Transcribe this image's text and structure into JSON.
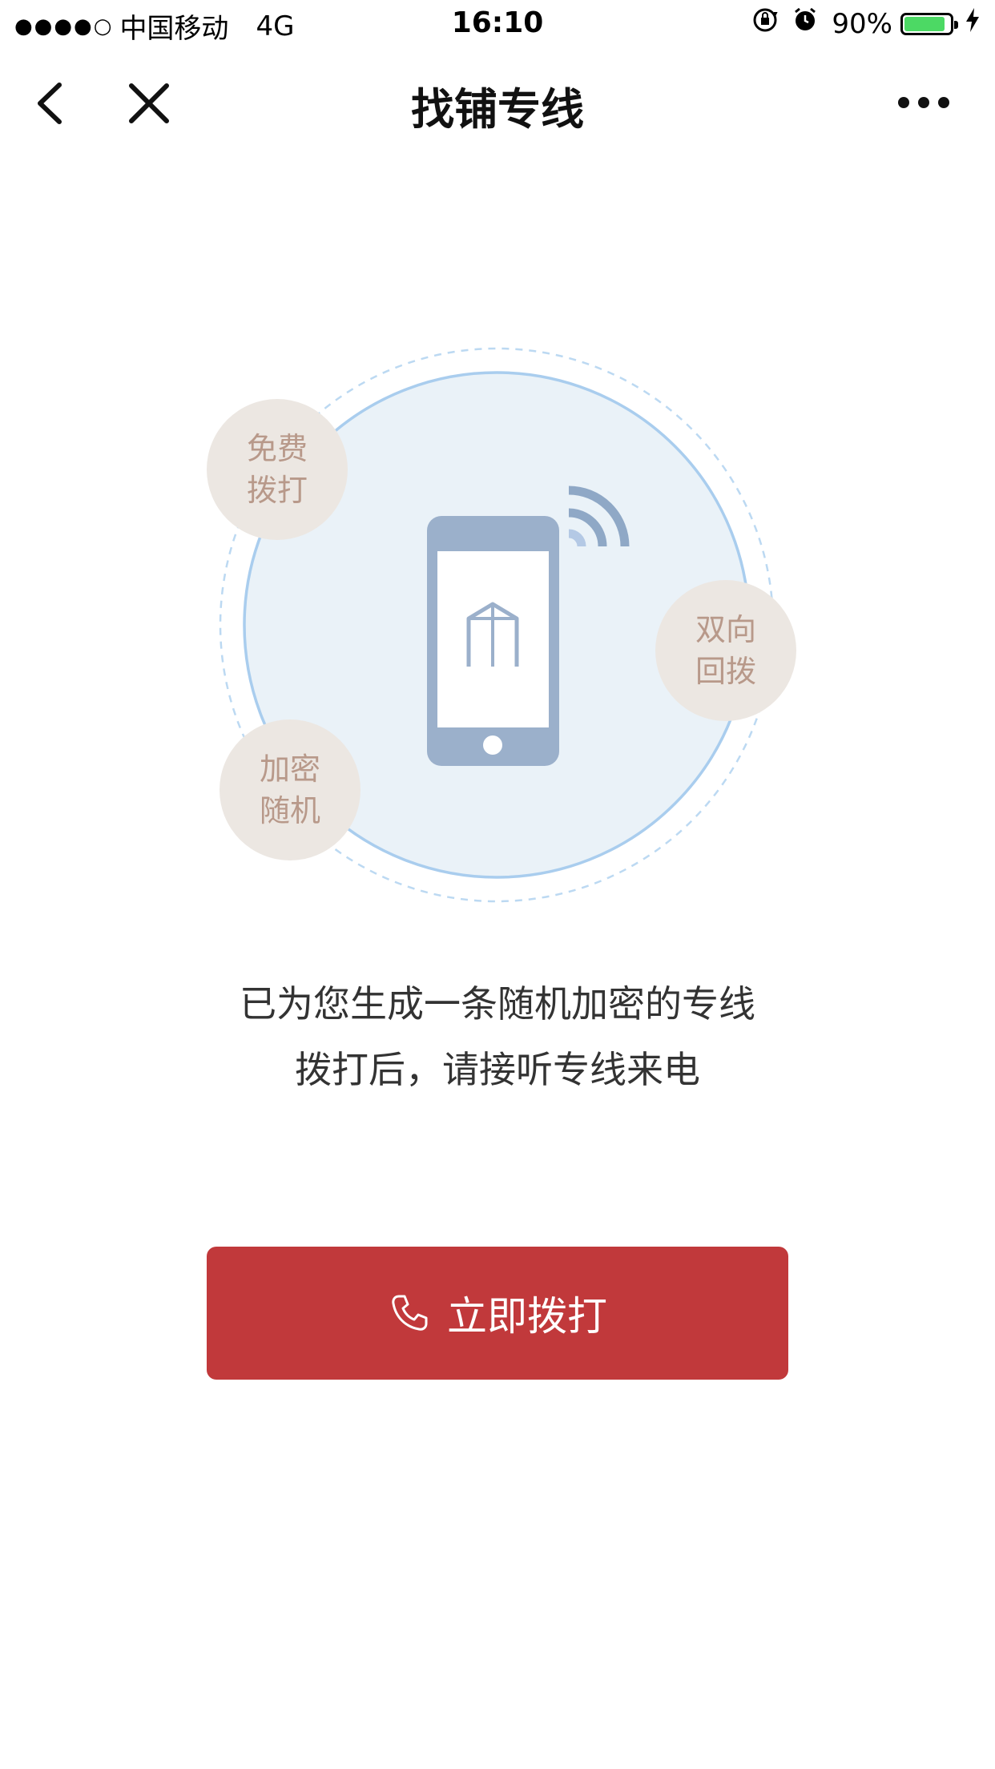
{
  "status_bar": {
    "signal": "●●●●○",
    "carrier": "中国移动",
    "network": "4G",
    "time": "16:10",
    "battery": "90%",
    "battery_level": 0.9
  },
  "nav": {
    "title": "找铺专线"
  },
  "features": {
    "free_line1": "免费",
    "free_line2": "拨打",
    "callback_line1": "双向",
    "callback_line2": "回拨",
    "secure_line1": "加密",
    "secure_line2": "随机"
  },
  "description": {
    "line1": "已为您生成一条随机加密的专线",
    "line2": "拨打后，请接听专线来电"
  },
  "action": {
    "call_label": "立即拨打"
  },
  "colors": {
    "primary_red": "#c1393b",
    "circle_fill": "#eaf2f8",
    "circle_stroke": "#a9cdee",
    "phone_blue": "#9bb0cb",
    "badge_bg": "#ece7e2",
    "badge_text": "#b8998a",
    "battery_green": "#4cd964"
  }
}
